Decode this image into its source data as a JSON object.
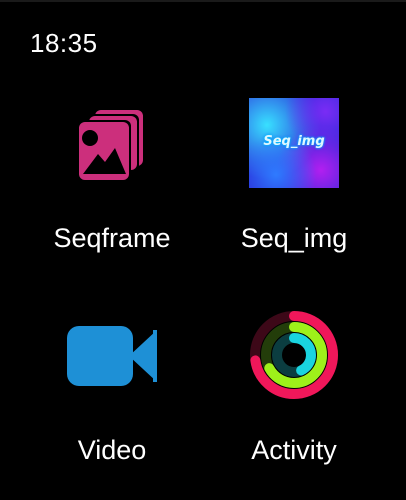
{
  "status_bar": {
    "time": "18:35"
  },
  "apps": [
    {
      "label": "Seqframe",
      "icon": "photo-stack-icon",
      "color": "#cc2f7c"
    },
    {
      "label": "Seq_img",
      "icon": "seq-img-thumbnail",
      "thumbnail_text": "Seq_img",
      "color": "#2a2ad8"
    },
    {
      "label": "Video",
      "icon": "video-camera-icon",
      "color": "#1e90d6"
    },
    {
      "label": "Activity",
      "icon": "activity-rings-icon",
      "colors": {
        "move": "#f0175a",
        "exercise": "#9ef01a",
        "stand": "#19d4e0"
      }
    }
  ]
}
